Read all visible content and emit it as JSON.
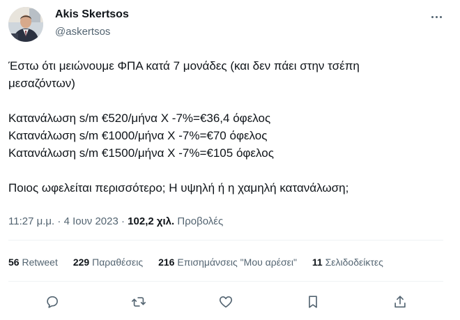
{
  "author": {
    "name": "Akis Skertsos",
    "handle": "@askertsos"
  },
  "tweet": {
    "lines": [
      "Έστω ότι μειώνουμε ΦΠΑ κατά 7 μονάδες (και δεν πάει στην τσέπη",
      "μεσαζόντων)",
      "",
      "Κατανάλωση s/m €520/μήνα Χ -7%=€36,4 όφελος",
      "Κατανάλωση s/m €1000/μήνα Χ -7%=€70 όφελος",
      "Κατανάλωση s/m €1500/μήνα Χ -7%=€105 όφελος",
      "",
      "Ποιος ωφελείται περισσότερο; Η υψηλή ή η χαμηλή κατανάλωση;"
    ]
  },
  "meta": {
    "time": "11:27 μ.μ.",
    "separator": "·",
    "date": "4 Ιουν 2023",
    "views_count": "102,2 χιλ.",
    "views_label": "Προβολές"
  },
  "stats": [
    {
      "count": "56",
      "label": "Retweet"
    },
    {
      "count": "229",
      "label": "Παραθέσεις"
    },
    {
      "count": "216",
      "label": "Επισημάνσεις \"Μου αρέσει\""
    },
    {
      "count": "11",
      "label": "Σελιδοδείκτες"
    }
  ],
  "icons": {
    "more": "more-horizontal-icon",
    "reply": "reply-icon",
    "retweet": "retweet-icon",
    "like": "heart-icon",
    "bookmark": "bookmark-icon",
    "share": "share-icon"
  },
  "colors": {
    "text": "#0f1419",
    "secondary": "#536471",
    "divider": "#eff3f4"
  }
}
